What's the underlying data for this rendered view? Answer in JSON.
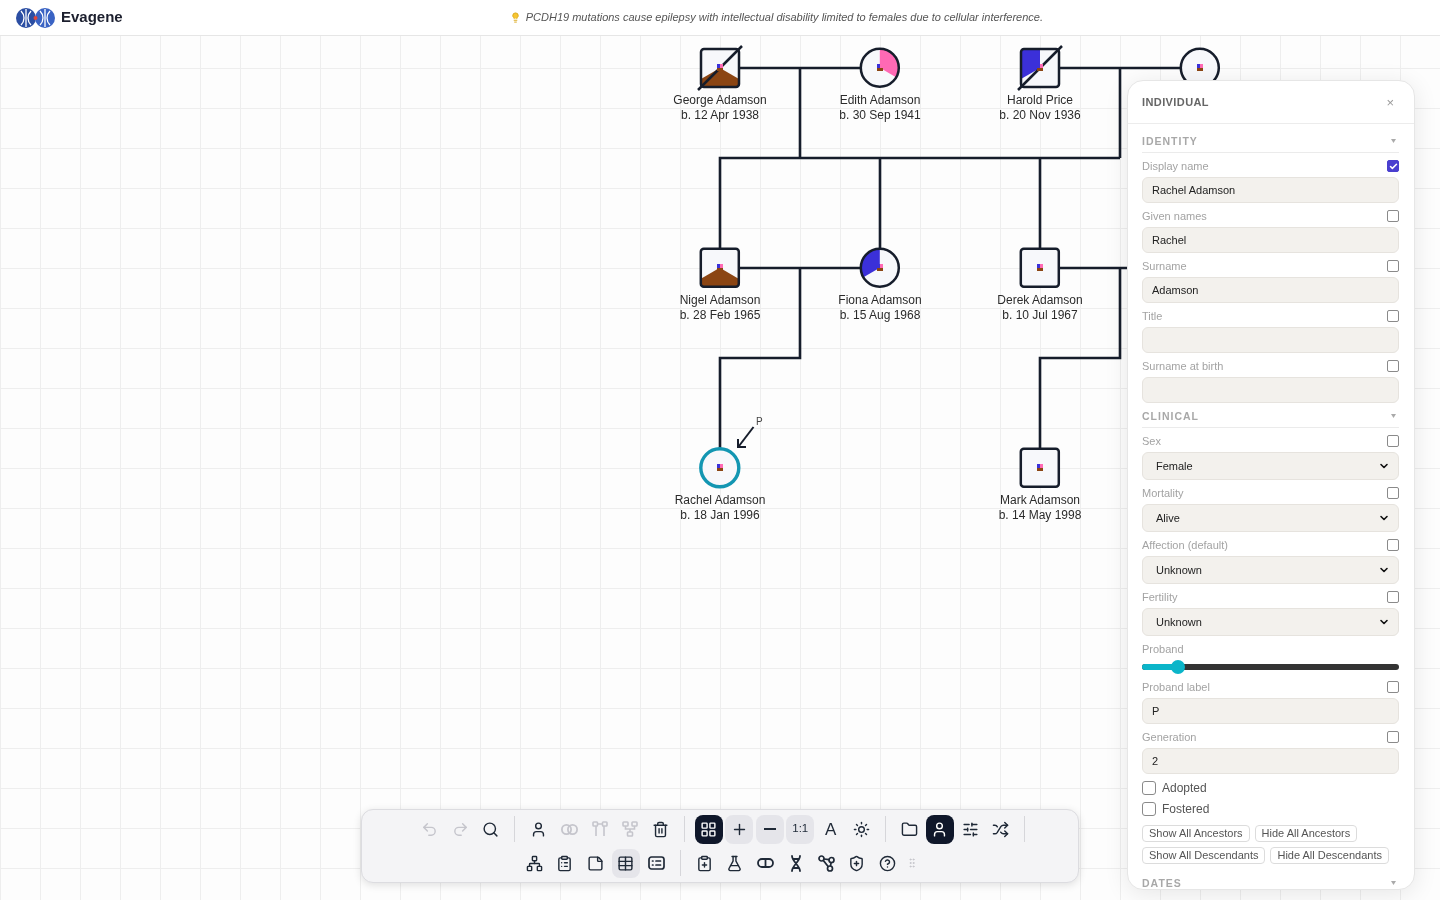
{
  "header": {
    "app_name": "Evagene",
    "banner": "PCDH19 mutations cause epilepsy with intellectual disability limited to females due to cellular interference."
  },
  "pedigree": {
    "conditions": [
      {
        "color": "#ff69b4"
      },
      {
        "color": "#8b4513"
      },
      {
        "color": "#3b30d9"
      }
    ],
    "individuals": [
      {
        "name": "George Adamson",
        "birth": "b. 12 Apr 1938",
        "kind": "male",
        "deceased": true,
        "selected": false,
        "affected": true,
        "color": "#8b4513"
      },
      {
        "name": "Edith Adamson",
        "birth": "b. 30 Sep 1941",
        "kind": "female",
        "deceased": false,
        "selected": false,
        "affected": true,
        "color": "#ff69b4"
      },
      {
        "name": "Harold Price",
        "birth": "b. 20 Nov 1936",
        "kind": "male",
        "deceased": true,
        "selected": false,
        "affected": true,
        "color": "#3b30d9"
      },
      {
        "kind": "female",
        "deceased": false,
        "selected": false,
        "affected": false
      },
      {
        "name": "Nigel Adamson",
        "birth": "b. 28 Feb 1965",
        "kind": "male",
        "deceased": false,
        "selected": false,
        "affected": true,
        "color": "#8b4513"
      },
      {
        "name": "Fiona Adamson",
        "birth": "b. 15 Aug 1968",
        "kind": "female",
        "deceased": false,
        "selected": false,
        "affected": true,
        "color": "#3b30d9"
      },
      {
        "name": "Derek Adamson",
        "birth": "b. 10 Jul 1967",
        "kind": "male",
        "deceased": false,
        "selected": false,
        "affected": false
      },
      {
        "name": "Rachel Adamson",
        "birth": "b. 18 Jan 1996",
        "kind": "female",
        "deceased": false,
        "selected": true,
        "affected": false,
        "proband_label": "P"
      },
      {
        "name": "Mark Adamson",
        "birth": "b. 14 May 1998",
        "kind": "male",
        "deceased": false,
        "selected": false,
        "affected": false
      }
    ]
  },
  "panel": {
    "title": "INDIVIDUAL",
    "close": "×",
    "sections": [
      {
        "title": "IDENTITY",
        "fields": [
          {
            "kind": "text",
            "label": "Display name",
            "checked": true,
            "value": "Rachel Adamson"
          },
          {
            "kind": "text",
            "label": "Given names",
            "checked": false,
            "value": "Rachel"
          },
          {
            "kind": "text",
            "label": "Surname",
            "checked": false,
            "value": "Adamson"
          },
          {
            "kind": "text",
            "label": "Title",
            "checked": false
          },
          {
            "kind": "text",
            "label": "Surname at birth",
            "checked": false
          }
        ]
      },
      {
        "title": "CLINICAL",
        "fields": [
          {
            "kind": "select",
            "label": "Sex",
            "checked": false,
            "value": "Female"
          },
          {
            "kind": "select",
            "label": "Mortality",
            "checked": false,
            "value": "Alive"
          },
          {
            "kind": "select",
            "label": "Affection (default)",
            "checked": false,
            "value": "Unknown"
          },
          {
            "kind": "select",
            "label": "Fertility",
            "checked": false,
            "value": "Unknown"
          },
          {
            "kind": "slider",
            "label": "Proband",
            "level": 0.14
          },
          {
            "kind": "text",
            "label": "Proband label",
            "checked": false,
            "value": "P"
          },
          {
            "kind": "text",
            "label": "Generation",
            "checked": false,
            "value": "2"
          },
          {
            "kind": "checkbox",
            "label": "Adopted",
            "checked": false
          },
          {
            "kind": "checkbox",
            "label": "Fostered",
            "checked": false
          },
          {
            "kind": "buttons",
            "rows": [
              [
                "Show All Ancestors",
                "Hide All Ancestors"
              ],
              [
                "Show All Descendants",
                "Hide All Descendants"
              ]
            ]
          }
        ]
      },
      {
        "title": "DATES"
      }
    ]
  },
  "toolbar": {
    "rows": [
      [
        {
          "kind": "button",
          "selected": false,
          "highlighted": false,
          "disabled": true
        },
        {
          "kind": "button",
          "selected": false,
          "highlighted": false,
          "disabled": true
        },
        {
          "kind": "button",
          "selected": false,
          "highlighted": false,
          "disabled": false
        },
        {
          "kind": "divider"
        },
        {
          "kind": "button",
          "selected": false,
          "highlighted": false,
          "disabled": false
        },
        {
          "kind": "button",
          "selected": false,
          "highlighted": false,
          "disabled": true
        },
        {
          "kind": "button",
          "selected": false,
          "highlighted": false,
          "disabled": true
        },
        {
          "kind": "button",
          "selected": false,
          "highlighted": false,
          "disabled": true
        },
        {
          "kind": "button",
          "selected": false,
          "highlighted": false,
          "disabled": false
        },
        {
          "kind": "divider"
        },
        {
          "kind": "button",
          "selected": true,
          "highlighted": false,
          "disabled": false
        },
        {
          "kind": "button",
          "selected": false,
          "highlighted": true,
          "disabled": false
        },
        {
          "kind": "button",
          "selected": false,
          "highlighted": true,
          "disabled": false
        },
        {
          "kind": "button",
          "selected": false,
          "highlighted": true,
          "disabled": false,
          "label": "1:1"
        },
        {
          "kind": "button",
          "selected": false,
          "highlighted": false,
          "disabled": false,
          "label": "A"
        },
        {
          "kind": "button",
          "selected": false,
          "highlighted": false,
          "disabled": false
        },
        {
          "kind": "divider"
        },
        {
          "kind": "button",
          "selected": false,
          "highlighted": false,
          "disabled": false
        },
        {
          "kind": "button",
          "selected": true,
          "highlighted": false,
          "disabled": false
        },
        {
          "kind": "button",
          "selected": false,
          "highlighted": false,
          "disabled": false
        },
        {
          "kind": "button",
          "selected": false,
          "highlighted": false,
          "disabled": false
        },
        {
          "kind": "divider"
        }
      ],
      [
        {
          "kind": "button",
          "selected": false,
          "highlighted": false,
          "disabled": false
        },
        {
          "kind": "button",
          "selected": false,
          "highlighted": false,
          "disabled": false
        },
        {
          "kind": "button",
          "selected": false,
          "highlighted": false,
          "disabled": false
        },
        {
          "kind": "button",
          "selected": false,
          "highlighted": true,
          "disabled": false
        },
        {
          "kind": "button",
          "selected": false,
          "highlighted": false,
          "disabled": false
        },
        {
          "kind": "divider"
        },
        {
          "kind": "button",
          "selected": false,
          "highlighted": false,
          "disabled": false
        },
        {
          "kind": "button",
          "selected": false,
          "highlighted": false,
          "disabled": false
        },
        {
          "kind": "button",
          "selected": false,
          "highlighted": false,
          "disabled": false
        },
        {
          "kind": "button",
          "selected": false,
          "highlighted": false,
          "disabled": false
        },
        {
          "kind": "button",
          "selected": false,
          "highlighted": false,
          "disabled": false
        },
        {
          "kind": "button",
          "selected": false,
          "highlighted": false,
          "disabled": false
        },
        {
          "kind": "button",
          "selected": false,
          "highlighted": false,
          "disabled": false
        },
        {
          "kind": "grip"
        }
      ]
    ]
  }
}
